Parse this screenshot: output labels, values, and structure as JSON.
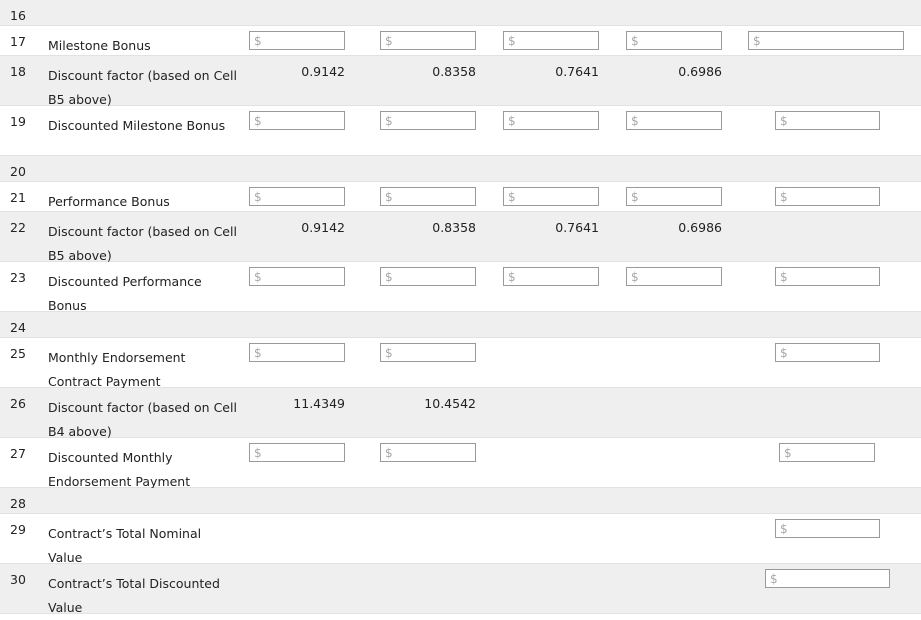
{
  "sheet": {
    "currency_placeholder": "$",
    "rows": [
      {
        "num": "16",
        "label": "",
        "type": "spacer",
        "shaded": true
      },
      {
        "num": "17",
        "label": "Milestone Bonus",
        "type": "inputs",
        "shaded": false,
        "inputs": [
          "c1",
          "c2",
          "c3",
          "c4",
          "c5wide"
        ]
      },
      {
        "num": "18",
        "label": "Discount factor (based on Cell B5 above)",
        "type": "factors",
        "shaded": true,
        "factors": [
          "0.9142",
          "0.8358",
          "0.7641",
          "0.6986"
        ]
      },
      {
        "num": "19",
        "label": "Discounted Milestone Bonus",
        "type": "inputs",
        "shaded": false,
        "inputs": [
          "c1",
          "c2",
          "c3",
          "c4",
          "c5"
        ]
      },
      {
        "num": "20",
        "label": "",
        "type": "spacer",
        "shaded": true
      },
      {
        "num": "21",
        "label": "Performance Bonus",
        "type": "inputs",
        "shaded": false,
        "inputs": [
          "c1",
          "c2",
          "c3",
          "c4",
          "c5"
        ]
      },
      {
        "num": "22",
        "label": "Discount factor (based on Cell B5 above)",
        "type": "factors",
        "shaded": true,
        "factors": [
          "0.9142",
          "0.8358",
          "0.7641",
          "0.6986"
        ]
      },
      {
        "num": "23",
        "label": "Discounted Performance Bonus",
        "type": "inputs",
        "shaded": false,
        "inputs": [
          "c1",
          "c2",
          "c3",
          "c4",
          "c5"
        ]
      },
      {
        "num": "24",
        "label": "",
        "type": "spacer",
        "shaded": true
      },
      {
        "num": "25",
        "label": "Monthly Endorsement Contract Payment",
        "type": "inputs",
        "shaded": false,
        "inputs": [
          "c1",
          "c2",
          "c5"
        ]
      },
      {
        "num": "26",
        "label": "Discount factor (based on Cell B4 above)",
        "type": "factors",
        "shaded": true,
        "factors": [
          "11.4349",
          "10.4542"
        ]
      },
      {
        "num": "27",
        "label": "Discounted Monthly Endorsement Payment",
        "type": "inputs",
        "shaded": false,
        "inputs": [
          "c1",
          "c2",
          "c5mid"
        ]
      },
      {
        "num": "28",
        "label": "",
        "type": "spacer",
        "shaded": true
      },
      {
        "num": "29",
        "label": "Contract’s Total Nominal Value",
        "type": "inputs",
        "shaded": false,
        "inputs": [
          "c5"
        ]
      },
      {
        "num": "30",
        "label": "Contract’s Total Discounted Value",
        "type": "inputs",
        "shaded": true,
        "inputs": [
          "c5low"
        ]
      }
    ]
  }
}
